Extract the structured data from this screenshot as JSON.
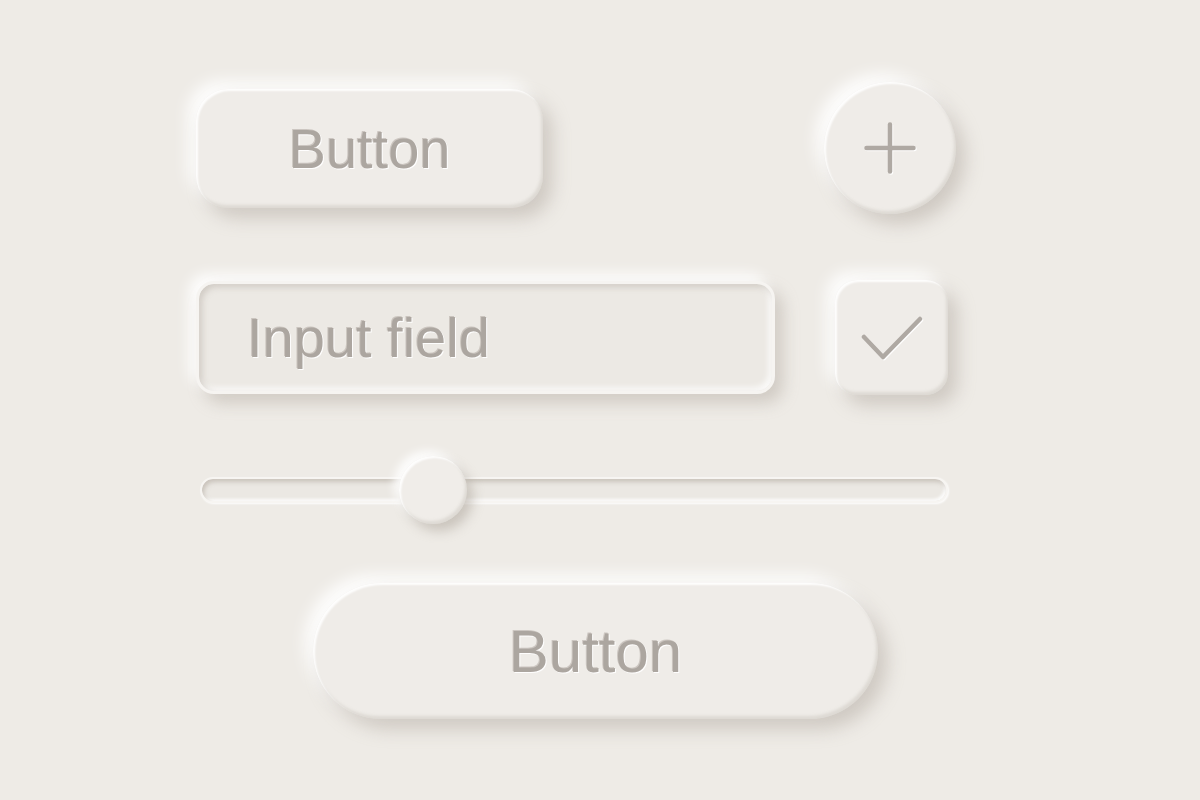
{
  "top_button": {
    "label": "Button"
  },
  "input_field": {
    "placeholder": "Input field"
  },
  "checkbox": {
    "checked": true
  },
  "slider": {
    "level": 0.31
  },
  "bottom_button": {
    "label": "Button"
  }
}
